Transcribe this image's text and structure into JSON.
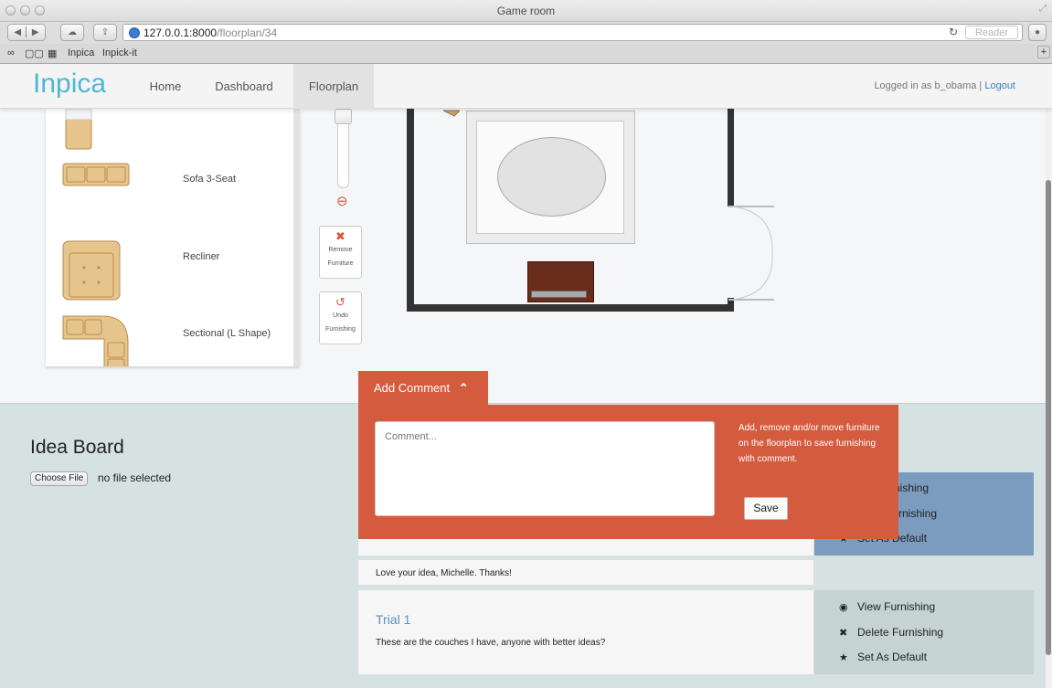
{
  "window": {
    "title": "Game room"
  },
  "browser": {
    "url_host": "127.0.0.1:8000",
    "url_path": "/floorplan/34",
    "reader_label": "Reader",
    "bookmarks": [
      "Inpica",
      "Inpick-it"
    ]
  },
  "nav": {
    "logo": "Inpica",
    "items": [
      {
        "label": "Home"
      },
      {
        "label": "Dashboard"
      },
      {
        "label": "Floorplan",
        "active": true
      }
    ],
    "login_prefix": "Logged in as b_obama | ",
    "logout_label": "Logout"
  },
  "furniture_panel": {
    "items": [
      {
        "label": "Sofa 3-Seat"
      },
      {
        "label": "Recliner"
      },
      {
        "label": "Sectional (L Shape)"
      }
    ]
  },
  "tools": {
    "remove_label": "Remove Furniture",
    "undo_label": "Undo Furnishing"
  },
  "idea_board": {
    "title": "Idea Board",
    "choose_file_label": "Choose File",
    "file_status": "no file selected"
  },
  "add_comment": {
    "tab_label": "Add Comment",
    "placeholder": "Comment...",
    "help_text": "Add, remove and/or move furniture on the floorplan to save furnishing with comment.",
    "save_label": "Save"
  },
  "comments": [
    {
      "reply_text": "Love your idea, Michelle. Thanks!",
      "actions": [
        "rnishing",
        "Furnishing",
        "Set As Default"
      ]
    },
    {
      "title": "Trial 1",
      "text": "These are the couches I have, anyone with better ideas?",
      "actions": [
        "View Furnishing",
        "Delete Furnishing",
        "Set As Default"
      ]
    }
  ],
  "colors": {
    "accent": "#d55b3f",
    "logo": "#4fb8d3",
    "card_blue": "#7b9cbf",
    "card_teal": "#c5d4d2",
    "ideaboard_bg": "#d6e1e1"
  }
}
